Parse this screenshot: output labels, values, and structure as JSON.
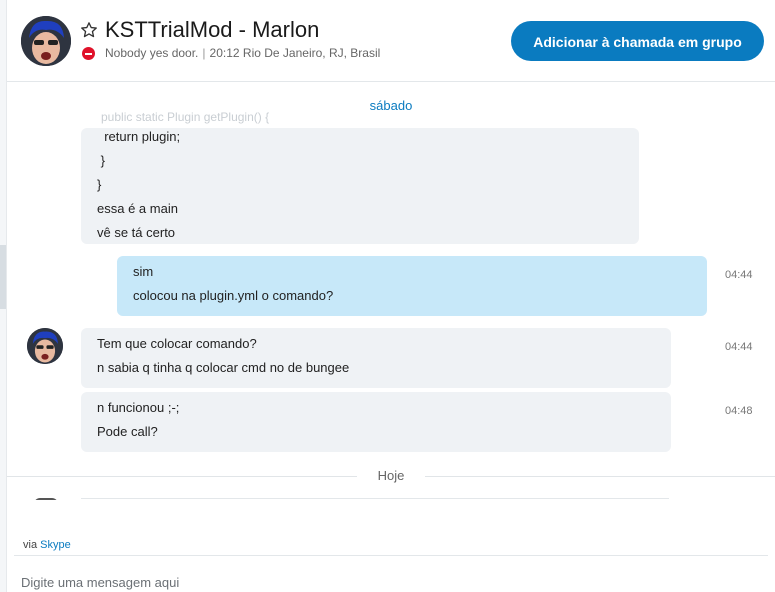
{
  "header": {
    "contact_name": "KSTTrialMod - Marlon",
    "status_text": "Nobody yes door.",
    "local_time": "20:12",
    "location": "Rio De Janeiro, RJ, Brasil",
    "add_call_button": "Adicionar à chamada em grupo",
    "icons": {
      "favorite": "star-outline-icon",
      "status": "do-not-disturb-icon"
    }
  },
  "chat": {
    "day_separator_1": "sábado",
    "ghost_line": "public static Plugin getPlugin() {",
    "messages": [
      {
        "direction": "incoming",
        "lines": [
          "  return plugin;",
          " }",
          "}",
          "essa é a main",
          "vê se tá certo"
        ],
        "time": ""
      },
      {
        "direction": "outgoing",
        "lines": [
          "sim",
          "colocou na plugin.yml o comando?"
        ],
        "time": "04:44"
      },
      {
        "direction": "incoming",
        "lines": [
          "Tem que colocar comando?",
          "n sabia q tinha q colocar cmd no de bungee"
        ],
        "time": "04:44"
      },
      {
        "direction": "incoming",
        "lines": [
          "n funcionou ;-;",
          "Pode call?"
        ],
        "time": "04:48"
      }
    ],
    "day_separator_2": "Hoje"
  },
  "footer": {
    "via_prefix": "via",
    "via_link": "Skype",
    "compose_placeholder": "Digite uma mensagem aqui"
  },
  "colors": {
    "accent": "#0a7bc0",
    "incoming_bubble": "#eff2f5",
    "outgoing_bubble": "#c7e8f9",
    "status_dnd": "#e0122a"
  }
}
